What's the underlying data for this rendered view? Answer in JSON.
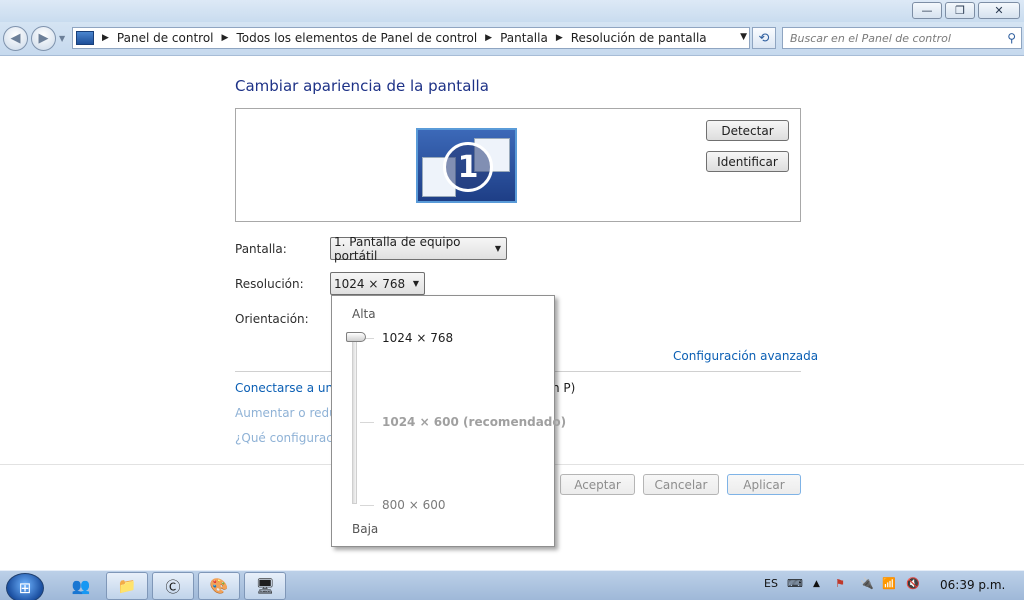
{
  "window": {
    "controls": {
      "minimize": "—",
      "maximize": "❐",
      "close": "✕"
    }
  },
  "addressbar": {
    "breadcrumb": [
      "Panel de control",
      "Todos los elementos de Panel de control",
      "Pantalla",
      "Resolución de pantalla"
    ],
    "search_placeholder": "Buscar en el Panel de control"
  },
  "content": {
    "heading": "Cambiar apariencia de la pantalla",
    "monitor_number": "1",
    "detect_button": "Detectar",
    "identify_button": "Identificar",
    "display_label": "Pantalla:",
    "display_value": "1. Pantalla de equipo portátil",
    "resolution_label": "Resolución:",
    "resolution_value": "1024 × 768",
    "orientation_label": "Orientación:",
    "advanced_link": "Configuración avanzada",
    "link_connect_start": "Conectarse a un p",
    "link_connect_end": "n P)",
    "link_enlarge": "Aumentar o reduc",
    "link_question": "¿Qué configuració",
    "accept_button": "Aceptar",
    "cancel_button": "Cancelar",
    "apply_button": "Aplicar"
  },
  "resolution_popup": {
    "high_label": "Alta",
    "low_label": "Baja",
    "options": [
      "1024 × 768",
      "1024 × 600 (recomendado)",
      "800 × 600"
    ],
    "selected": "1024 × 768"
  },
  "taskbar": {
    "language": "ES",
    "time": "06:39 p.m.",
    "icons": [
      "windows-start-icon",
      "users-icon",
      "file-explorer-icon",
      "ccleaner-icon",
      "paint-icon",
      "display-settings-icon"
    ]
  }
}
